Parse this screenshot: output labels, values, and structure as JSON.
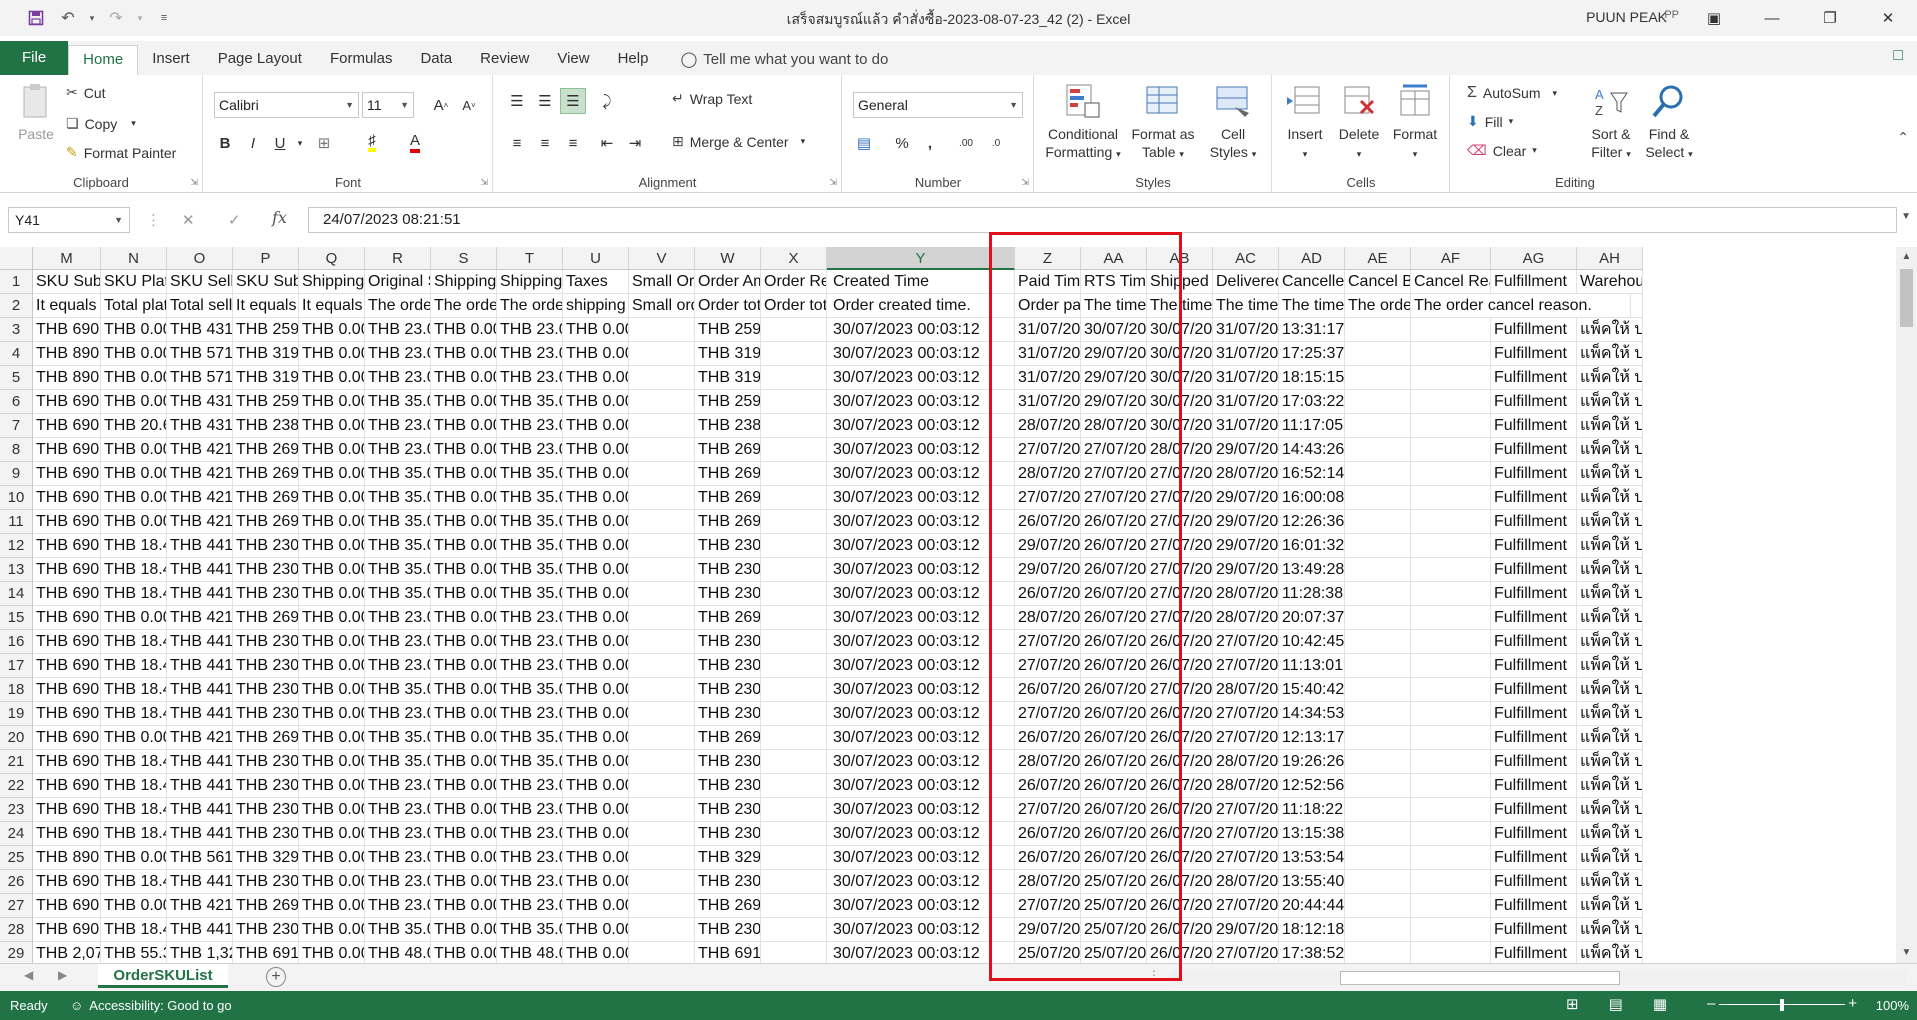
{
  "window": {
    "title": "เสร็จสมบูรณ์แล้ว คำสั่งซื้อ-2023-08-07-23_42 (2)  -  Excel",
    "user": "PUUN PEAK",
    "avatar_initials": "PP"
  },
  "tabs": [
    "File",
    "Home",
    "Insert",
    "Page Layout",
    "Formulas",
    "Data",
    "Review",
    "View",
    "Help"
  ],
  "tell_me": "Tell me what you want to do",
  "ribbon": {
    "clipboard": {
      "label": "Clipboard",
      "paste": "Paste",
      "cut": "Cut",
      "copy": "Copy",
      "format_painter": "Format Painter"
    },
    "font": {
      "label": "Font",
      "name": "Calibri",
      "size": "11"
    },
    "alignment": {
      "label": "Alignment",
      "wrap": "Wrap Text",
      "merge": "Merge & Center"
    },
    "number": {
      "label": "Number",
      "format": "General"
    },
    "styles": {
      "label": "Styles",
      "conditional_line1": "Conditional",
      "conditional_line2": "Formatting",
      "format_table_line1": "Format as",
      "format_table_line2": "Table",
      "cell_styles_line1": "Cell",
      "cell_styles_line2": "Styles"
    },
    "cells": {
      "label": "Cells",
      "insert": "Insert",
      "delete": "Delete",
      "format": "Format"
    },
    "editing": {
      "label": "Editing",
      "autosum": "AutoSum",
      "fill": "Fill",
      "clear": "Clear",
      "sort_line1": "Sort &",
      "sort_line2": "Filter",
      "find_line1": "Find &",
      "find_line2": "Select"
    }
  },
  "formula_bar": {
    "name_box": "Y41",
    "value": "24/07/2023 08:21:51"
  },
  "columns": [
    {
      "letter": "M",
      "h1": "SKU Subtotal",
      "h2": "It equals to",
      "vals": [
        "THB 690.0",
        "THB 890.0",
        "THB 890.0",
        "THB 690.0",
        "THB 690.0",
        "THB 690.0",
        "THB 690.0",
        "THB 690.0",
        "THB 690.0",
        "THB 690.0",
        "THB 690.0",
        "THB 690.0",
        "THB 690.0",
        "THB 690.0",
        "THB 690.0",
        "THB 690.0",
        "THB 690.0",
        "THB 690.0",
        "THB 690.0",
        "THB 690.0",
        "THB 690.0",
        "THB 690.0",
        "THB 890.0",
        "THB 690.0",
        "THB 690.0",
        "THB 690.0",
        "THB 2,070"
      ]
    },
    {
      "letter": "N",
      "h1": "SKU Platform",
      "h2": "Total platf",
      "vals": [
        "THB 0.00",
        "THB 0.00",
        "THB 0.00",
        "THB 0.00",
        "THB 20.60",
        "THB 0.00",
        "THB 0.00",
        "THB 0.00",
        "THB 0.00",
        "THB 18.44",
        "THB 18.44",
        "THB 18.44",
        "THB 0.00",
        "THB 18.44",
        "THB 18.44",
        "THB 18.44",
        "THB 18.44",
        "THB 0.00",
        "THB 18.44",
        "THB 18.44",
        "THB 18.44",
        "THB 18.44",
        "THB 0.00",
        "THB 18.44",
        "THB 0.00",
        "THB 18.44",
        "THB 55.32"
      ]
    },
    {
      "letter": "O",
      "h1": "SKU Seller",
      "h2": "Total seller",
      "vals": [
        "THB 431.0",
        "THB 571.0",
        "THB 571.0",
        "THB 431.0",
        "THB 431.0",
        "THB 421.0",
        "THB 421.0",
        "THB 421.0",
        "THB 421.0",
        "THB 441.0",
        "THB 441.0",
        "THB 441.0",
        "THB 421.0",
        "THB 441.0",
        "THB 441.0",
        "THB 441.0",
        "THB 441.0",
        "THB 421.0",
        "THB 441.0",
        "THB 441.0",
        "THB 441.0",
        "THB 441.0",
        "THB 561.0",
        "THB 441.0",
        "THB 421.0",
        "THB 441.0",
        "THB 1,323"
      ]
    },
    {
      "letter": "P",
      "h1": "SKU Subtotal",
      "h2": "It equals S",
      "vals": [
        "THB 259.0",
        "THB 319.0",
        "THB 319.0",
        "THB 259.0",
        "THB 238.4",
        "THB 269.0",
        "THB 269.0",
        "THB 269.0",
        "THB 269.0",
        "THB 230.5",
        "THB 230.5",
        "THB 230.5",
        "THB 269.0",
        "THB 230.5",
        "THB 230.5",
        "THB 230.5",
        "THB 230.5",
        "THB 269.0",
        "THB 230.5",
        "THB 230.5",
        "THB 230.5",
        "THB 230.5",
        "THB 329.0",
        "THB 230.5",
        "THB 269.0",
        "THB 230.5",
        "THB 691.6"
      ]
    },
    {
      "letter": "Q",
      "h1": "Shipping Fee",
      "h2": "It equals to",
      "vals": [
        "THB 0.00",
        "THB 0.00",
        "THB 0.00",
        "THB 0.00",
        "THB 0.00",
        "THB 0.00",
        "THB 0.00",
        "THB 0.00",
        "THB 0.00",
        "THB 0.00",
        "THB 0.00",
        "THB 0.00",
        "THB 0.00",
        "THB 0.00",
        "THB 0.00",
        "THB 0.00",
        "THB 0.00",
        "THB 0.00",
        "THB 0.00",
        "THB 0.00",
        "THB 0.00",
        "THB 0.00",
        "THB 0.00",
        "THB 0.00",
        "THB 0.00",
        "THB 0.00",
        "THB 0.00"
      ]
    },
    {
      "letter": "R",
      "h1": "Original Shipping",
      "h2": "The order's",
      "vals": [
        "THB 23.00",
        "THB 23.00",
        "THB 23.00",
        "THB 35.00",
        "THB 23.00",
        "THB 23.00",
        "THB 35.00",
        "THB 35.00",
        "THB 35.00",
        "THB 35.00",
        "THB 35.00",
        "THB 35.00",
        "THB 23.00",
        "THB 23.00",
        "THB 23.00",
        "THB 35.00",
        "THB 23.00",
        "THB 35.00",
        "THB 35.00",
        "THB 23.00",
        "THB 23.00",
        "THB 23.00",
        "THB 23.00",
        "THB 23.00",
        "THB 23.00",
        "THB 35.00",
        "THB 48.00"
      ]
    },
    {
      "letter": "S",
      "h1": "Shipping Fee",
      "h2": "The order's",
      "vals": [
        "THB 0.00",
        "THB 0.00",
        "THB 0.00",
        "THB 0.00",
        "THB 0.00",
        "THB 0.00",
        "THB 0.00",
        "THB 0.00",
        "THB 0.00",
        "THB 0.00",
        "THB 0.00",
        "THB 0.00",
        "THB 0.00",
        "THB 0.00",
        "THB 0.00",
        "THB 0.00",
        "THB 0.00",
        "THB 0.00",
        "THB 0.00",
        "THB 0.00",
        "THB 0.00",
        "THB 0.00",
        "THB 0.00",
        "THB 0.00",
        "THB 0.00",
        "THB 0.00",
        "THB 0.00"
      ]
    },
    {
      "letter": "T",
      "h1": "Shipping Fee",
      "h2": "The order's",
      "vals": [
        "THB 23.00",
        "THB 23.00",
        "THB 23.00",
        "THB 35.00",
        "THB 23.00",
        "THB 23.00",
        "THB 35.00",
        "THB 35.00",
        "THB 35.00",
        "THB 35.00",
        "THB 35.00",
        "THB 35.00",
        "THB 23.00",
        "THB 23.00",
        "THB 23.00",
        "THB 35.00",
        "THB 23.00",
        "THB 35.00",
        "THB 35.00",
        "THB 23.00",
        "THB 23.00",
        "THB 23.00",
        "THB 23.00",
        "THB 23.00",
        "THB 23.00",
        "THB 35.00",
        "THB 48.00"
      ]
    },
    {
      "letter": "U",
      "h1": "Taxes",
      "h2": "shipping f",
      "vals": [
        "THB 0.00",
        "THB 0.00",
        "THB 0.00",
        "THB 0.00",
        "THB 0.00",
        "THB 0.00",
        "THB 0.00",
        "THB 0.00",
        "THB 0.00",
        "THB 0.00",
        "THB 0.00",
        "THB 0.00",
        "THB 0.00",
        "THB 0.00",
        "THB 0.00",
        "THB 0.00",
        "THB 0.00",
        "THB 0.00",
        "THB 0.00",
        "THB 0.00",
        "THB 0.00",
        "THB 0.00",
        "THB 0.00",
        "THB 0.00",
        "THB 0.00",
        "THB 0.00",
        "THB 0.00"
      ]
    },
    {
      "letter": "V",
      "h1": "Small Order",
      "h2": "Small orde",
      "vals": [
        "",
        "",
        "",
        "",
        "",
        "",
        "",
        "",
        "",
        "",
        "",
        "",
        "",
        "",
        "",
        "",
        "",
        "",
        "",
        "",
        "",
        "",
        "",
        "",
        "",
        "",
        ""
      ]
    },
    {
      "letter": "W",
      "h1": "Order Amount",
      "h2": "Order tota",
      "vals": [
        "THB 259.00",
        "THB 319.00",
        "THB 319.00",
        "THB 259.00",
        "THB 238.40",
        "THB 269.00",
        "THB 269.00",
        "THB 269.00",
        "THB 269.00",
        "THB 230.56",
        "THB 230.56",
        "THB 230.56",
        "THB 269.00",
        "THB 230.56",
        "THB 230.56",
        "THB 230.56",
        "THB 230.56",
        "THB 269.00",
        "THB 230.56",
        "THB 230.56",
        "THB 230.56",
        "THB 230.56",
        "THB 329.00",
        "THB 230.56",
        "THB 269.00",
        "THB 230.56",
        "THB 691.68"
      ]
    },
    {
      "letter": "X",
      "h1": "Order Refund",
      "h2": "Order tota",
      "vals": [
        "",
        "",
        "",
        "",
        "",
        "",
        "",
        "",
        "",
        "",
        "",
        "",
        "",
        "",
        "",
        "",
        "",
        "",
        "",
        "",
        "",
        "",
        "",
        "",
        "",
        "",
        ""
      ]
    },
    {
      "letter": "Y",
      "h1": "Created Time",
      "h2": "Order created time.",
      "vals": [
        "30/07/2023 00:03:12",
        "30/07/2023 00:03:12",
        "30/07/2023 00:03:12",
        "30/07/2023 00:03:12",
        "30/07/2023 00:03:12",
        "30/07/2023 00:03:12",
        "30/07/2023 00:03:12",
        "30/07/2023 00:03:12",
        "30/07/2023 00:03:12",
        "30/07/2023 00:03:12",
        "30/07/2023 00:03:12",
        "30/07/2023 00:03:12",
        "30/07/2023 00:03:12",
        "30/07/2023 00:03:12",
        "30/07/2023 00:03:12",
        "30/07/2023 00:03:12",
        "30/07/2023 00:03:12",
        "30/07/2023 00:03:12",
        "30/07/2023 00:03:12",
        "30/07/2023 00:03:12",
        "30/07/2023 00:03:12",
        "30/07/2023 00:03:12",
        "30/07/2023 00:03:12",
        "30/07/2023 00:03:12",
        "30/07/2023 00:03:12",
        "30/07/2023 00:03:12",
        "30/07/2023 00:03:12"
      ]
    },
    {
      "letter": "Z",
      "h1": "Paid Time",
      "h2": "Order paid",
      "vals": [
        "31/07/202",
        "31/07/202",
        "31/07/202",
        "31/07/202",
        "28/07/202",
        "27/07/202",
        "28/07/202",
        "27/07/202",
        "26/07/202",
        "29/07/202",
        "29/07/202",
        "26/07/202",
        "28/07/202",
        "27/07/202",
        "27/07/202",
        "26/07/202",
        "27/07/202",
        "26/07/202",
        "28/07/202",
        "26/07/202",
        "27/07/202",
        "26/07/202",
        "26/07/202",
        "28/07/202",
        "27/07/202",
        "29/07/202",
        "25/07/202"
      ]
    },
    {
      "letter": "AA",
      "h1": "RTS Time",
      "h2": "The time w",
      "vals": [
        "30/07/202",
        "29/07/202",
        "29/07/202",
        "29/07/202",
        "28/07/202",
        "27/07/202",
        "27/07/202",
        "27/07/202",
        "26/07/202",
        "26/07/202",
        "26/07/202",
        "26/07/202",
        "26/07/202",
        "26/07/202",
        "26/07/202",
        "26/07/202",
        "26/07/202",
        "26/07/202",
        "26/07/202",
        "26/07/202",
        "26/07/202",
        "26/07/202",
        "26/07/202",
        "25/07/202",
        "25/07/202",
        "25/07/202",
        "25/07/202"
      ]
    },
    {
      "letter": "AB",
      "h1": "Shipped Time",
      "h2": "The time w",
      "vals": [
        "30/07/202",
        "30/07/202",
        "30/07/202",
        "30/07/202",
        "30/07/202",
        "28/07/202",
        "27/07/202",
        "27/07/202",
        "27/07/202",
        "27/07/202",
        "27/07/202",
        "27/07/202",
        "27/07/202",
        "26/07/202",
        "26/07/202",
        "27/07/202",
        "26/07/202",
        "26/07/202",
        "26/07/202",
        "26/07/202",
        "26/07/202",
        "26/07/202",
        "26/07/202",
        "26/07/202",
        "26/07/202",
        "26/07/202",
        "26/07/202"
      ]
    },
    {
      "letter": "AC",
      "h1": "Delivered Time",
      "h2": "The time w",
      "vals": [
        "31/07/2023",
        "31/07/2023",
        "31/07/2023",
        "31/07/2023",
        "31/07/2023",
        "29/07/2023",
        "28/07/2023",
        "29/07/2023",
        "29/07/2023",
        "29/07/2023",
        "29/07/2023",
        "28/07/2023",
        "28/07/2023",
        "27/07/2023",
        "27/07/2023",
        "28/07/2023",
        "27/07/2023",
        "27/07/2023",
        "28/07/2023",
        "28/07/2023",
        "27/07/2023",
        "27/07/2023",
        "27/07/2023",
        "28/07/2023",
        "27/07/2023",
        "29/07/2023",
        "27/07/2023"
      ]
    },
    {
      "letter": "AD",
      "h1": "Cancelled",
      "h2": "The time w",
      "vals": [
        "13:31:17",
        "17:25:37",
        "18:15:15",
        "17:03:22",
        "11:17:05",
        "14:43:26",
        "16:52:14",
        "16:00:08",
        "12:26:36",
        "16:01:32",
        "13:49:28",
        "11:28:38",
        "20:07:37",
        "10:42:45",
        "11:13:01",
        "15:40:42",
        "14:34:53",
        "12:13:17",
        "19:26:26",
        "12:52:56",
        "11:18:22",
        "13:15:38",
        "13:53:54",
        "13:55:40",
        "20:44:44",
        "18:12:18",
        "17:38:52"
      ]
    },
    {
      "letter": "AE",
      "h1": "Cancel By",
      "h2": "The order",
      "vals": [
        "",
        "",
        "",
        "",
        "",
        "",
        "",
        "",
        "",
        "",
        "",
        "",
        "",
        "",
        "",
        "",
        "",
        "",
        "",
        "",
        "",
        "",
        "",
        "",
        "",
        "",
        ""
      ]
    },
    {
      "letter": "AF",
      "h1": "Cancel Reason",
      "h2": "The order cancel reason.",
      "vals": [
        "",
        "",
        "",
        "",
        "",
        "",
        "",
        "",
        "",
        "",
        "",
        "",
        "",
        "",
        "",
        "",
        "",
        "",
        "",
        "",
        "",
        "",
        "",
        "",
        "",
        "",
        ""
      ]
    },
    {
      "letter": "AG",
      "h1": "Fulfillment",
      "h2": "",
      "vals": [
        "Fulfillment",
        "Fulfillment",
        "Fulfillment",
        "Fulfillment",
        "Fulfillment",
        "Fulfillment",
        "Fulfillment",
        "Fulfillment",
        "Fulfillment",
        "Fulfillment",
        "Fulfillment",
        "Fulfillment",
        "Fulfillment",
        "Fulfillment",
        "Fulfillment",
        "Fulfillment",
        "Fulfillment",
        "Fulfillment",
        "Fulfillment",
        "Fulfillment",
        "Fulfillment",
        "Fulfillment",
        "Fulfillment",
        "Fulfillment",
        "Fulfillment",
        "Fulfillment",
        "Fulfillment"
      ]
    },
    {
      "letter": "AH",
      "h1": "Warehouse",
      "h2": "",
      "vals": [
        "แพ็คให้ บ",
        "แพ็คให้ บ",
        "แพ็คให้ บ",
        "แพ็คให้ บ",
        "แพ็คให้ บ",
        "แพ็คให้ บ",
        "แพ็คให้ บ",
        "แพ็คให้ บ",
        "แพ็คให้ บ",
        "แพ็คให้ บ",
        "แพ็คให้ บ",
        "แพ็คให้ บ",
        "แพ็คให้ บ",
        "แพ็คให้ บ",
        "แพ็คให้ บ",
        "แพ็คให้ บ",
        "แพ็คให้ บ",
        "แพ็คให้ บ",
        "แพ็คให้ บ",
        "แพ็คให้ บ",
        "แพ็คให้ บ",
        "แพ็คให้ บ",
        "แพ็คให้ บ",
        "แพ็คให้ บ",
        "แพ็คให้ บ",
        "แพ็คให้ บ",
        "แพ็คให้ บ"
      ]
    }
  ],
  "sheet": {
    "tab": "OrderSKUList"
  },
  "status": {
    "ready": "Ready",
    "accessibility": "Accessibility: Good to go",
    "zoom": "100%",
    "zoom_level_pct": 100
  },
  "colors": {
    "accent": "#217346",
    "highlight_border": "#e0101a"
  }
}
